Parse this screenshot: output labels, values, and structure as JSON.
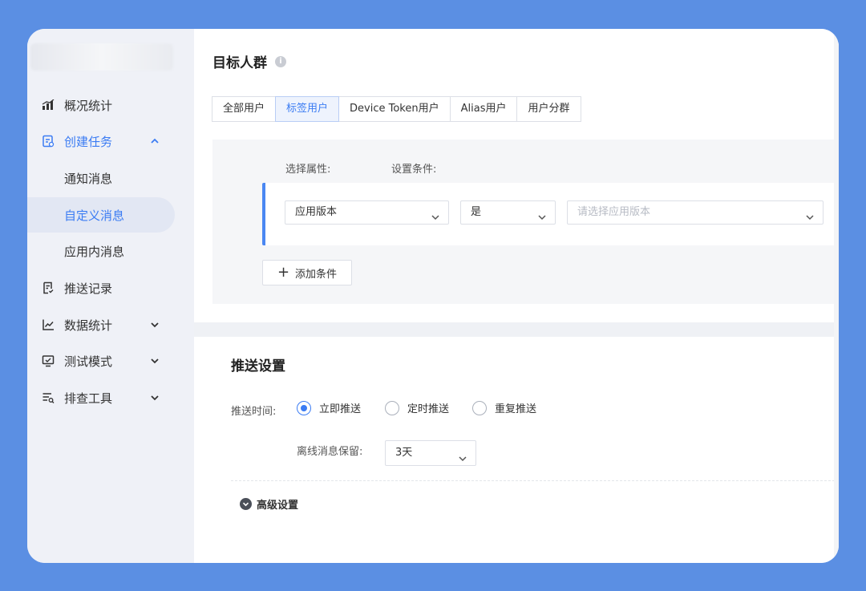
{
  "sidebar": {
    "items": [
      {
        "label": "概况统计",
        "icon": "bar-chart-icon"
      },
      {
        "label": "创建任务",
        "icon": "task-doc-icon",
        "expanded": true
      },
      {
        "label": "推送记录",
        "icon": "record-doc-icon"
      },
      {
        "label": "数据统计",
        "icon": "line-chart-icon"
      },
      {
        "label": "测试模式",
        "icon": "monitor-icon"
      },
      {
        "label": "排查工具",
        "icon": "list-tool-icon"
      }
    ],
    "sub_items": [
      {
        "label": "通知消息"
      },
      {
        "label": "自定义消息",
        "selected": true
      },
      {
        "label": "应用内消息"
      }
    ]
  },
  "target": {
    "title": "目标人群",
    "tabs": [
      "全部用户",
      "标签用户",
      "Device Token用户",
      "Alias用户",
      "用户分群"
    ],
    "active_tab": "标签用户",
    "select_attr_label": "选择属性:",
    "set_cond_label": "设置条件:",
    "attr_value": "应用版本",
    "op_value": "是",
    "value_placeholder": "请选择应用版本",
    "add_condition": "添加条件"
  },
  "push": {
    "title": "推送设置",
    "time_label": "推送时间:",
    "options": [
      "立即推送",
      "定时推送",
      "重复推送"
    ],
    "selected_option": "立即推送",
    "offline_label": "离线消息保留:",
    "offline_value": "3天",
    "advanced": "高级设置"
  },
  "colors": {
    "accent": "#3b7cf3",
    "background": "#5b8fe3",
    "sidebar": "#eff1f7"
  }
}
